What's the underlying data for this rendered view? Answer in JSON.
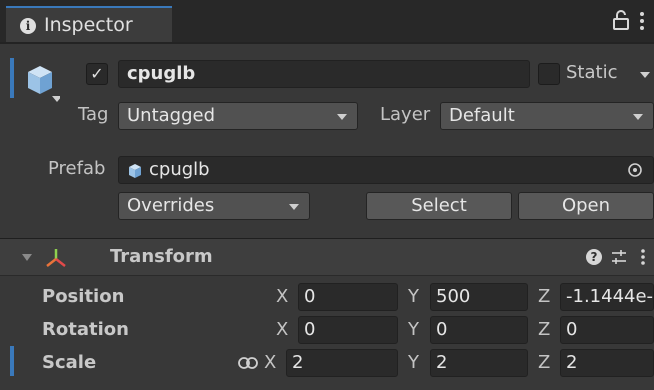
{
  "window": {
    "tab_label": "Inspector"
  },
  "object": {
    "active_checked": true,
    "name": "cpuglb",
    "static_label": "Static",
    "static_checked": false,
    "tag_label": "Tag",
    "tag_value": "Untagged",
    "layer_label": "Layer",
    "layer_value": "Default"
  },
  "prefab": {
    "label": "Prefab",
    "asset_name": "cpuglb",
    "overrides_label": "Overrides",
    "select_label": "Select",
    "open_label": "Open"
  },
  "transform": {
    "title": "Transform",
    "position": {
      "label": "Position",
      "x": "0",
      "y": "500",
      "z": "-1.1444e-"
    },
    "rotation": {
      "label": "Rotation",
      "x": "0",
      "y": "0",
      "z": "0"
    },
    "scale": {
      "label": "Scale",
      "x": "2",
      "y": "2",
      "z": "2"
    },
    "axis_labels": {
      "x": "X",
      "y": "Y",
      "z": "Z"
    }
  },
  "colors": {
    "panel_bg": "#383838",
    "field_bg": "#2a2a2a",
    "accent_blue": "#3a79bb"
  },
  "icons": {
    "info": "info-icon",
    "lock": "lock-icon",
    "kebab": "kebab-menu-icon",
    "gameobject": "cube-icon",
    "prefab": "prefab-cube-icon",
    "target": "object-picker-icon",
    "transform": "transform-axes-icon",
    "help": "help-icon",
    "presets": "presets-icon",
    "link": "link-icon"
  }
}
